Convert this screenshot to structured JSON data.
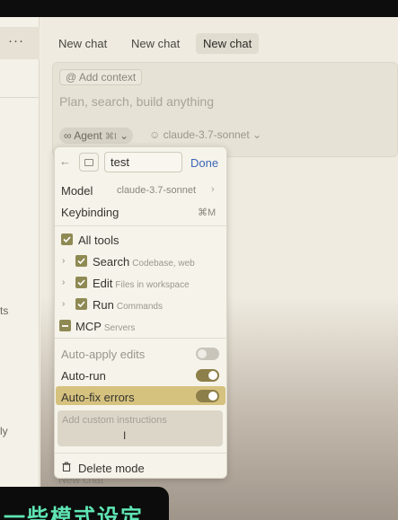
{
  "sidebar": {
    "menu_glyph": "···",
    "fragments": [
      "ts",
      "ly"
    ]
  },
  "tabs": [
    "New chat",
    "New chat",
    "New chat"
  ],
  "composer": {
    "context_label": "@ Add context",
    "placeholder": "Plan, search, build anything",
    "agent_label": "∞ Agent",
    "agent_shortcut": "⌘I",
    "agent_chevron": "⌄",
    "model_label": "claude-3.7-sonnet",
    "model_chevron": "⌄"
  },
  "mode_panel": {
    "back_glyph": "←",
    "name_value": "test",
    "done_label": "Done",
    "model": {
      "label": "Model",
      "value": "claude-3.7-sonnet",
      "chevron": "›"
    },
    "keybinding": {
      "label": "Keybinding",
      "value": "⌘M"
    },
    "tools": {
      "all_label": "All tools",
      "items": [
        {
          "label": "Search",
          "description": "Codebase, web"
        },
        {
          "label": "Edit",
          "description": "Files in workspace"
        },
        {
          "label": "Run",
          "description": "Commands"
        }
      ],
      "mcp_label": "MCP",
      "mcp_description": "Servers"
    },
    "toggles": [
      {
        "label": "Auto-apply edits",
        "state": "off"
      },
      {
        "label": "Auto-run",
        "state": "on"
      },
      {
        "label": "Auto-fix errors",
        "state": "on"
      }
    ],
    "instructions_placeholder": "Add custom instructions",
    "delete_label": "Delete mode"
  },
  "background_text": "New chat",
  "subtitle": "一些模式设定",
  "colors": {
    "accent_link": "#3b66b7",
    "checkbox": "#8f8a54",
    "toggle_on": "#8c7f49",
    "highlight_row": "#d6c27f",
    "subtitle_text": "#5fe6b4"
  }
}
